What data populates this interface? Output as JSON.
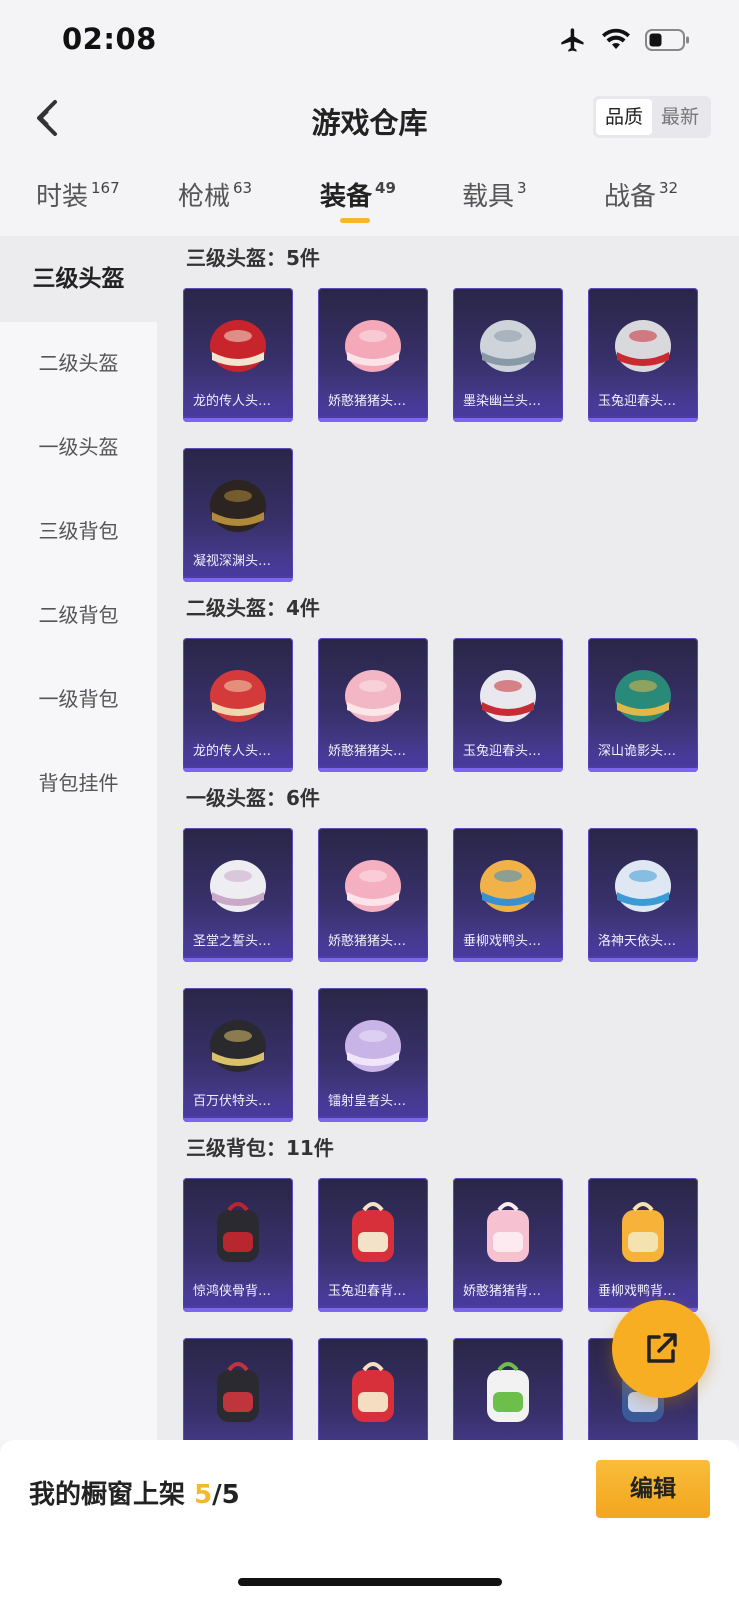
{
  "status_bar": {
    "time": "02:08"
  },
  "header": {
    "title": "游戏仓库",
    "sort_options": [
      "品质",
      "最新"
    ],
    "active_sort": "品质"
  },
  "tabs": [
    {
      "label": "时装",
      "count": "167"
    },
    {
      "label": "枪械",
      "count": "63"
    },
    {
      "label": "装备",
      "count": "49"
    },
    {
      "label": "载具",
      "count": "3"
    },
    {
      "label": "战备",
      "count": "32"
    }
  ],
  "active_tab": "装备",
  "sidebar": {
    "items": [
      "三级头盔",
      "二级头盔",
      "一级头盔",
      "三级背包",
      "二级背包",
      "一级背包",
      "背包挂件"
    ],
    "active": "三级头盔"
  },
  "sections": [
    {
      "title": "三级头盔：5件",
      "items": [
        "龙的传人头…",
        "娇憨猪猪头…",
        "墨染幽兰头…",
        "玉兔迎春头…",
        "凝视深渊头…"
      ]
    },
    {
      "title": "二级头盔：4件",
      "items": [
        "龙的传人头…",
        "娇憨猪猪头…",
        "玉兔迎春头…",
        "深山诡影头…"
      ]
    },
    {
      "title": "一级头盔：6件",
      "items": [
        "圣堂之誓头…",
        "娇憨猪猪头…",
        "垂柳戏鸭头…",
        "洛神天依头…",
        "百万伏特头…",
        "镭射皇者头…"
      ]
    },
    {
      "title": "三级背包：11件",
      "items": [
        "惊鸿侠骨背…",
        "玉兔迎春背…",
        "娇憨猪猪背…",
        "垂柳戏鸭背…",
        "",
        "",
        "",
        ""
      ]
    }
  ],
  "bottom_bar": {
    "label": "我的橱窗上架",
    "count_current": "5",
    "count_total": "/5",
    "edit_label": "编辑"
  },
  "colors": {
    "accent": "#f5b82a",
    "card_bg": "#38306a",
    "card_border": "#7c66ee",
    "fab": "#f7ae22"
  }
}
